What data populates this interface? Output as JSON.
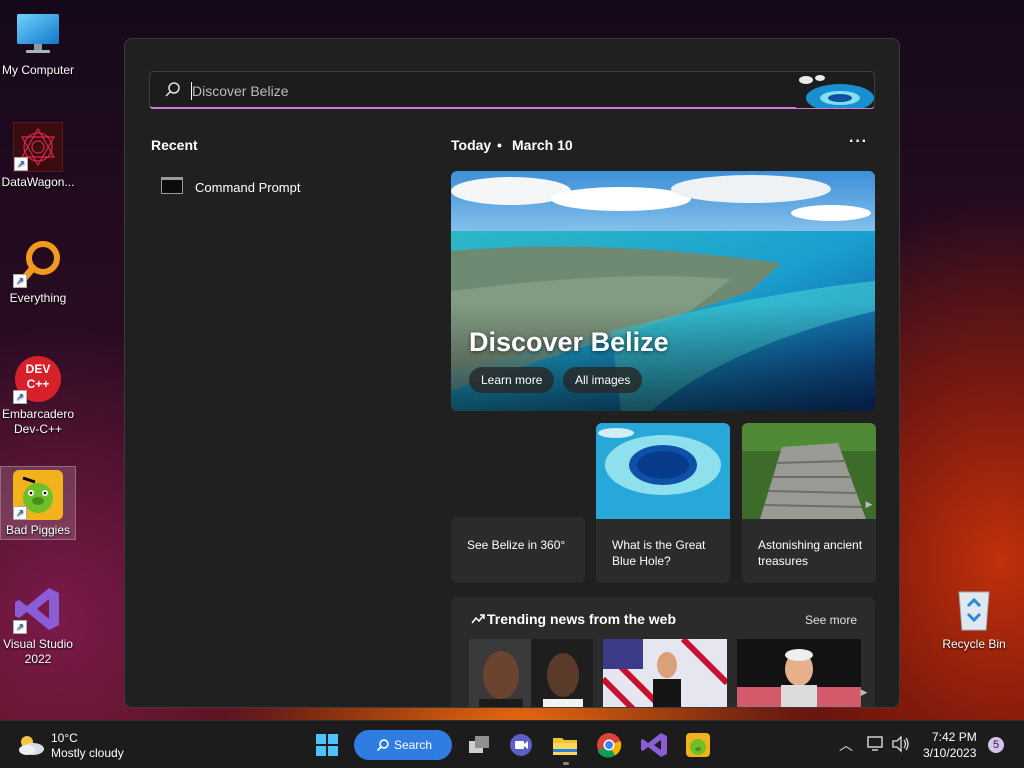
{
  "desktop": {
    "icons": [
      {
        "label": "My Computer"
      },
      {
        "label": "DataWagon..."
      },
      {
        "label": "Everything"
      },
      {
        "label": "Embarcadero Dev-C++"
      },
      {
        "label": "Bad Piggies"
      },
      {
        "label": "Visual Studio 2022"
      },
      {
        "label": "Recycle Bin"
      }
    ],
    "icon_glyphs": {
      "devcpp": "DEV C++"
    }
  },
  "search": {
    "query": "Discover Belize",
    "icon": "search-icon"
  },
  "recent": {
    "heading": "Recent",
    "items": [
      {
        "label": "Command Prompt",
        "icon": "command-prompt-icon"
      }
    ]
  },
  "today": {
    "label": "Today",
    "separator": "•",
    "date": "March 10",
    "menu": "···"
  },
  "hero": {
    "title": "Discover Belize",
    "learn_more": "Learn more",
    "all_images": "All images"
  },
  "cards": [
    {
      "caption": "See Belize in 360°"
    },
    {
      "caption": "What is the Great Blue Hole?"
    },
    {
      "caption": "Astonishing ancient treasures"
    }
  ],
  "trending": {
    "title": "Trending news from the web",
    "see_more": "See more"
  },
  "taskbar": {
    "weather": {
      "temp": "10°C",
      "condition": "Mostly cloudy"
    },
    "search_label": "Search",
    "clock": {
      "time": "7:42 PM",
      "date": "3/10/2023"
    },
    "notifications": "5"
  },
  "colors": {
    "accent_blue": "#2f7de1",
    "search_underline": "#d17ad6",
    "panel_bg": "#202020",
    "card_bg": "#2b2b2b"
  }
}
